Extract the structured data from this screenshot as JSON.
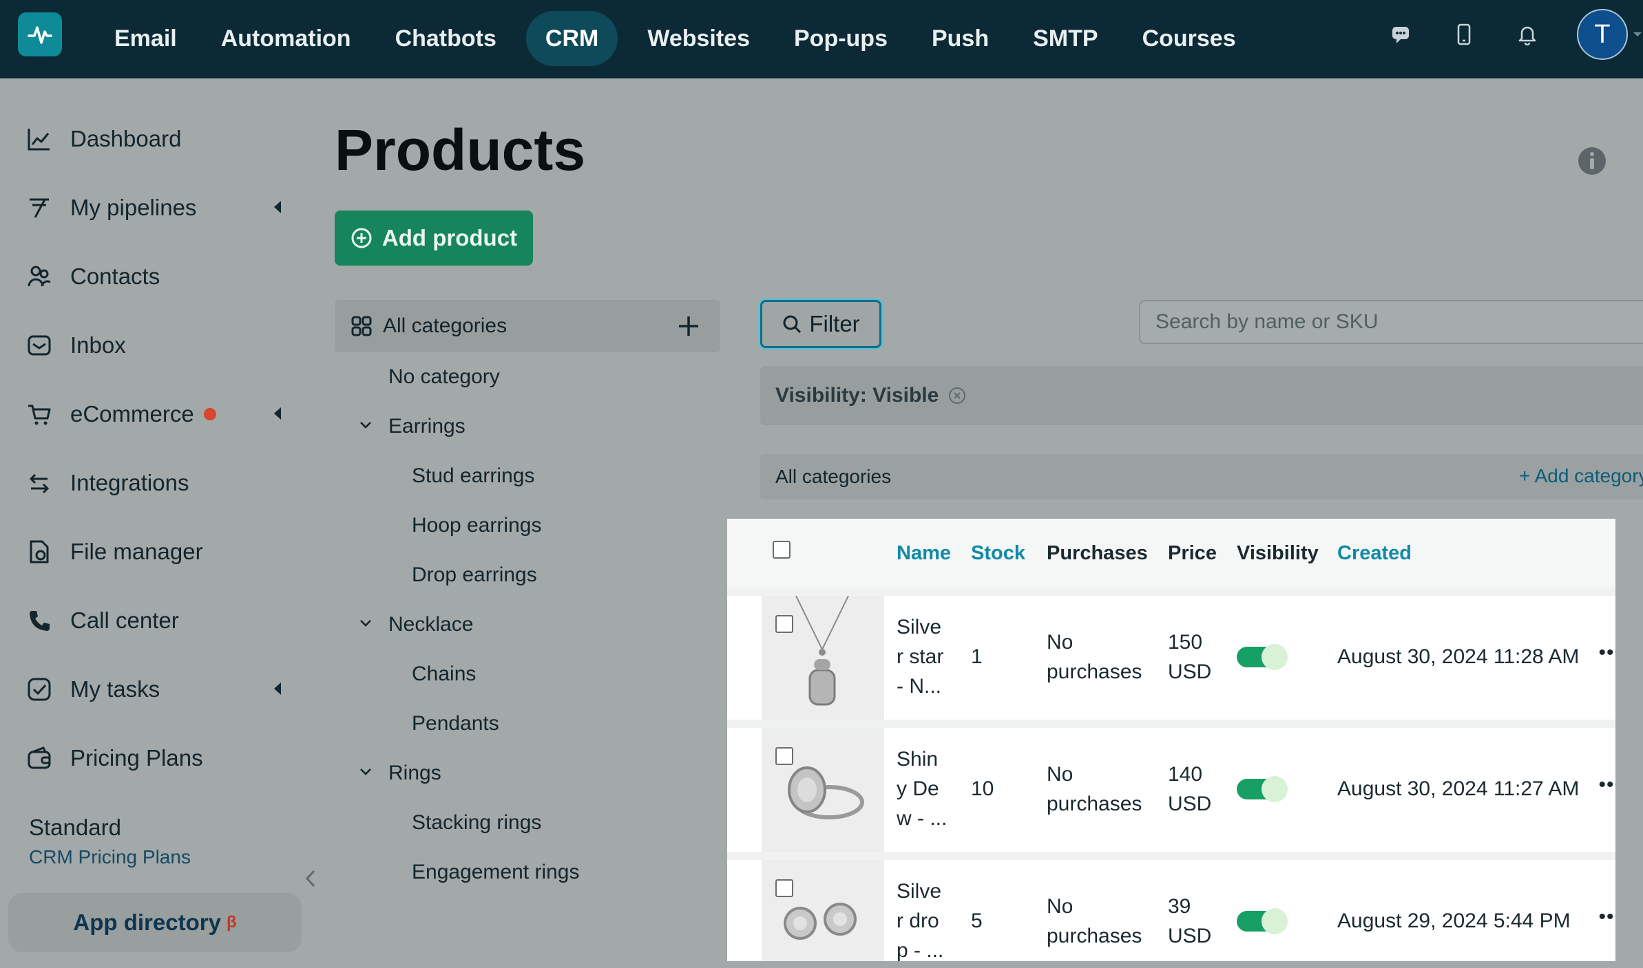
{
  "nav": {
    "items": [
      "Email",
      "Automation",
      "Chatbots",
      "CRM",
      "Websites",
      "Pop-ups",
      "Push",
      "SMTP",
      "Courses"
    ],
    "active": "CRM",
    "avatar_initial": "T"
  },
  "sidebar": {
    "items": [
      {
        "label": "Dashboard",
        "icon": "chart-line-icon"
      },
      {
        "label": "My pipelines",
        "icon": "pipeline-icon"
      },
      {
        "label": "Contacts",
        "icon": "contacts-icon"
      },
      {
        "label": "Inbox",
        "icon": "inbox-icon"
      },
      {
        "label": "eCommerce",
        "icon": "cart-icon"
      },
      {
        "label": "Integrations",
        "icon": "integrations-icon"
      },
      {
        "label": "File manager",
        "icon": "file-manager-icon"
      },
      {
        "label": "Call center",
        "icon": "phone-icon"
      },
      {
        "label": "My tasks",
        "icon": "tasks-icon"
      },
      {
        "label": "Pricing Plans",
        "icon": "wallet-icon"
      }
    ],
    "plan_name": "Standard",
    "plan_sub": "CRM Pricing Plans",
    "app_directory": "App directory",
    "beta_mark": "β"
  },
  "page": {
    "title": "Products",
    "add_button": "Add product"
  },
  "categories": {
    "all": "All categories",
    "no_category": "No category",
    "groups": [
      {
        "label": "Earrings",
        "children": [
          "Stud earrings",
          "Hoop earrings",
          "Drop earrings"
        ]
      },
      {
        "label": "Necklace",
        "children": [
          "Chains",
          "Pendants"
        ]
      },
      {
        "label": "Rings",
        "children": [
          "Stacking rings",
          "Engagement rings"
        ]
      }
    ]
  },
  "toolbar": {
    "filter_label": "Filter",
    "search_placeholder": "Search by name or SKU",
    "chip": "Visibility: Visible",
    "breadcrumb": "All categories",
    "add_category": "+ Add category"
  },
  "table": {
    "headers": {
      "name": "Name",
      "stock": "Stock",
      "purchases": "Purchases",
      "price": "Price",
      "visibility": "Visibility",
      "created": "Created"
    },
    "rows": [
      {
        "name": [
          "Silve",
          "r star",
          "- N..."
        ],
        "stock": "1",
        "purchases": [
          "No",
          "purchases"
        ],
        "price": [
          "150",
          "USD"
        ],
        "created": "August 30, 2024 11:28 AM"
      },
      {
        "name": [
          "Shin",
          "y De",
          "w - ..."
        ],
        "stock": "10",
        "purchases": [
          "No",
          "purchases"
        ],
        "price": [
          "140",
          "USD"
        ],
        "created": "August 30, 2024 11:27 AM"
      },
      {
        "name": [
          "Silve",
          "r dro",
          "p - ..."
        ],
        "stock": "5",
        "purchases": [
          "No",
          "purchases"
        ],
        "price": [
          "39",
          "USD"
        ],
        "created": "August 29, 2024 5:44 PM"
      }
    ]
  }
}
